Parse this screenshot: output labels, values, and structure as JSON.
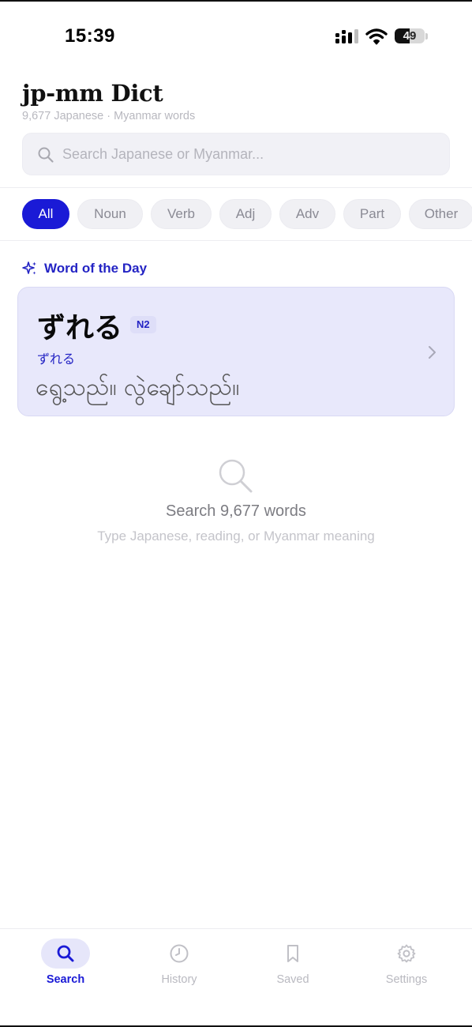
{
  "status_bar": {
    "time": "15:39",
    "battery": "49",
    "battery_level": 0.49
  },
  "header": {
    "title": "jp-mm Dict",
    "subtitle": "9,677 Japanese · Myanmar words"
  },
  "search": {
    "placeholder": "Search Japanese or Myanmar...",
    "value": ""
  },
  "filters": [
    {
      "label": "All",
      "active": true
    },
    {
      "label": "Noun",
      "active": false
    },
    {
      "label": "Verb",
      "active": false
    },
    {
      "label": "Adj",
      "active": false
    },
    {
      "label": "Adv",
      "active": false
    },
    {
      "label": "Part",
      "active": false
    },
    {
      "label": "Other",
      "active": false
    }
  ],
  "word_of_day": {
    "label": "Word of the Day",
    "word": "ずれる",
    "level": "N2",
    "reading": "ずれる",
    "meaning": "ရွေ့သည်။ လွဲချော်သည်။"
  },
  "empty_state": {
    "title": "Search 9,677 words",
    "hint": "Type Japanese, reading, or Myanmar meaning"
  },
  "tabs": [
    {
      "label": "Search",
      "icon": "search-icon",
      "active": true
    },
    {
      "label": "History",
      "icon": "clock-icon",
      "active": false
    },
    {
      "label": "Saved",
      "icon": "bookmark-icon",
      "active": false
    },
    {
      "label": "Settings",
      "icon": "gear-icon",
      "active": false
    }
  ],
  "colors": {
    "accent": "#1a1ad6",
    "card_bg": "#e8e8fb",
    "chip_bg": "#f0f0f4"
  }
}
